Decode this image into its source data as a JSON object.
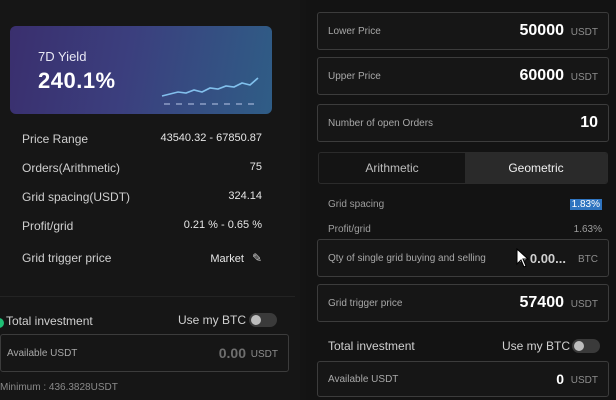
{
  "yield_card": {
    "label": "7D Yield",
    "value": "240.1%"
  },
  "stats": [
    {
      "key": "Price Range",
      "value": "43540.32 - 67850.87"
    },
    {
      "key": "Orders(Arithmetic)",
      "value": "75"
    },
    {
      "key": "Grid spacing(USDT)",
      "value": "324.14"
    },
    {
      "key": "Profit/grid",
      "value": "0.21 % - 0.65 %"
    },
    {
      "key": "Grid trigger price",
      "value": "Market"
    }
  ],
  "left_investment": {
    "title": "Total investment",
    "use_btc_label": "Use my BTC",
    "available_label": "Available USDT",
    "amount": "0.00",
    "unit": "USDT",
    "minimum": "Minimum : 436.3828USDT"
  },
  "right_form": {
    "lower_price": {
      "label": "Lower Price",
      "value": "50000",
      "unit": "USDT"
    },
    "upper_price": {
      "label": "Upper Price",
      "value": "60000",
      "unit": "USDT"
    },
    "open_orders": {
      "label": "Number of open Orders",
      "value": "10"
    },
    "tabs": {
      "arithmetic": "Arithmetic",
      "geometric": "Geometric"
    },
    "grid_spacing": {
      "label": "Grid spacing",
      "value": "1.83%"
    },
    "profit_grid": {
      "label": "Profit/grid",
      "value": "1.63%"
    },
    "qty_grid": {
      "label": "Qty of single grid buying and selling",
      "value": "> 0.00...",
      "unit": "BTC"
    },
    "trigger_price": {
      "label": "Grid trigger price",
      "value": "57400",
      "unit": "USDT"
    },
    "investment_title": "Total investment",
    "use_btc_label": "Use my BTC",
    "available": {
      "label": "Available USDT",
      "value": "0",
      "unit": "USDT"
    }
  },
  "colors": {
    "background": "#141414",
    "highlight": "#2f74c0",
    "accent_green": "#1fbf75"
  },
  "icons": [
    "edit-pencil-icon",
    "toggle-switch",
    "mouse-cursor-icon"
  ]
}
